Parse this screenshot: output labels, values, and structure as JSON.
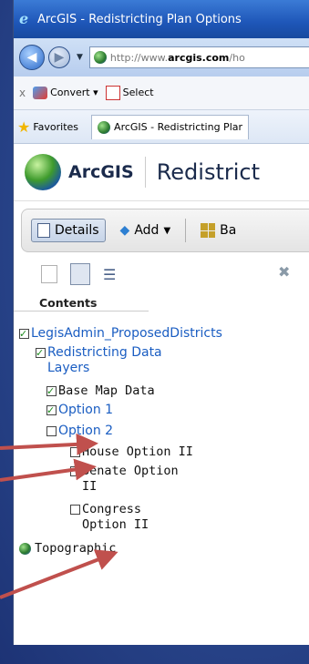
{
  "window": {
    "title": "ArcGIS - Redistricting Plan Options"
  },
  "nav": {
    "url_prefix": "http://www.",
    "url_domain": "arcgis.com",
    "url_suffix": "/ho"
  },
  "command_bar": {
    "close": "x",
    "convert_label": "Convert",
    "select_label": "Select"
  },
  "favorites_bar": {
    "favorites_label": "Favorites",
    "tab_title": "ArcGIS - Redistricting Plar"
  },
  "app": {
    "brand": "ArcGIS",
    "title": "Redistrict"
  },
  "toolbar": {
    "details_label": "Details",
    "add_label": "Add",
    "basemap_label": "Ba"
  },
  "panel": {
    "contents_heading": "Contents"
  },
  "tree": [
    {
      "label": "LegisAdmin_ProposedDistricts",
      "checked": true,
      "style": "link"
    },
    {
      "label": "Redistricting Data\nLayers",
      "checked": true,
      "style": "link"
    },
    {
      "label": "Base Map Data",
      "checked": true,
      "style": "plain"
    },
    {
      "label": "Option 1",
      "checked": true,
      "style": "link"
    },
    {
      "label": "Option 2",
      "checked": false,
      "style": "link"
    },
    {
      "label": "House Option II",
      "checked": false,
      "style": "plain"
    },
    {
      "label": "Senate Option\nII",
      "checked": false,
      "style": "plain"
    },
    {
      "label": "Congress\nOption II",
      "checked": false,
      "style": "plain"
    },
    {
      "label": "Topographic",
      "checked": null,
      "style": "plain"
    }
  ],
  "colors": {
    "arrow": "#c0504d",
    "background": "#2d4c93",
    "link": "#1a5dc2"
  }
}
